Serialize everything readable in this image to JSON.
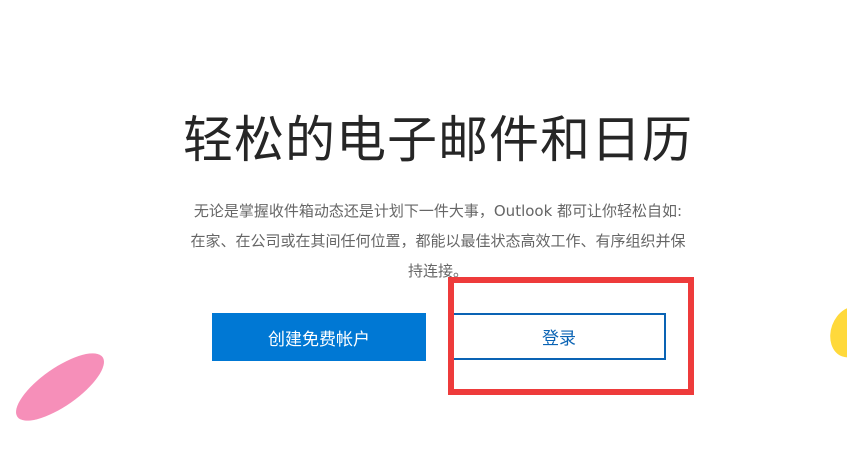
{
  "hero": {
    "title": "轻松的电子邮件和日历",
    "description_lines": [
      "无论是掌握收件箱动态还是计划下一件大事，Outlook 都可让你轻松自如:",
      "在家、在公司或在其间任何位置，都能以最佳状态高效工作、有序组织并保",
      "持连接。"
    ]
  },
  "actions": {
    "create_account_label": "创建免费帐户",
    "sign_in_label": "登录"
  },
  "colors": {
    "primary_button": "#0078d4",
    "secondary_border": "#0a63b4",
    "highlight_box": "#ee3b3b",
    "decor_pink": "#f68fb9",
    "decor_yellow": "#ffd93b"
  }
}
